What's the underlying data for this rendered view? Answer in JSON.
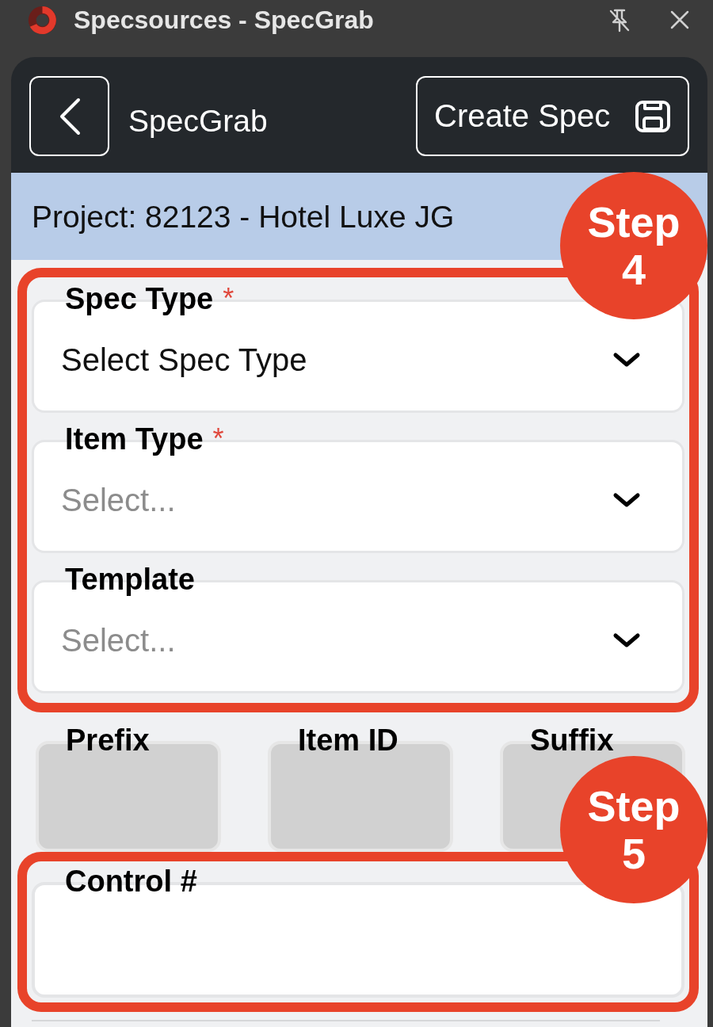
{
  "window": {
    "title": "Specsources - SpecGrab"
  },
  "header": {
    "title": "SpecGrab",
    "action": {
      "label": "Create Spec"
    }
  },
  "project_bar": {
    "text": "Project: 82123 - Hotel Luxe JG"
  },
  "form": [
    {
      "kind": "highlight",
      "step": "Step 4",
      "fields": [
        {
          "kind": "select",
          "label": "Spec Type",
          "required_mark": "*",
          "value": "Select Spec Type",
          "disabled": false
        },
        {
          "kind": "select",
          "label": "Item Type",
          "required_mark": "*",
          "placeholder": "Select...",
          "disabled": false
        },
        {
          "kind": "select",
          "label": "Template",
          "placeholder": "Select...",
          "disabled": false
        }
      ]
    },
    {
      "kind": "row",
      "fields": [
        {
          "kind": "text",
          "label": "Prefix",
          "disabled": true
        },
        {
          "kind": "text",
          "label": "Item ID",
          "disabled": true
        },
        {
          "kind": "text",
          "label": "Suffix",
          "disabled": true
        }
      ]
    },
    {
      "kind": "highlight",
      "step": "Step 5",
      "fields": [
        {
          "kind": "text",
          "label": "Control #",
          "disabled": false
        }
      ]
    }
  ]
}
